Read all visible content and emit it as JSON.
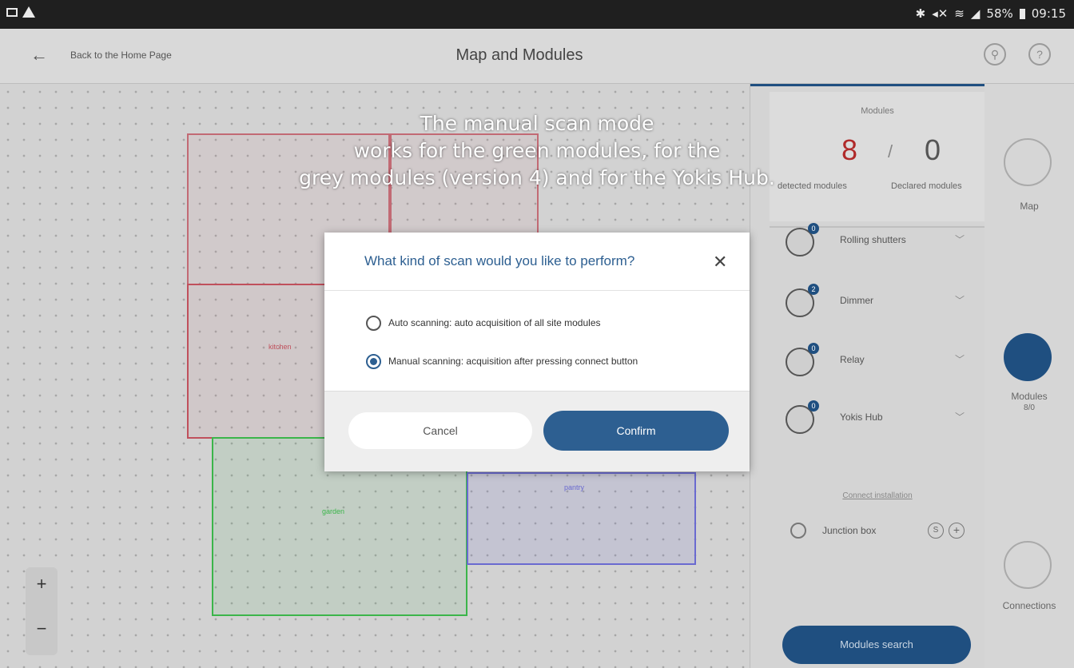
{
  "status_bar": {
    "battery": "58%",
    "time": "09:15"
  },
  "header": {
    "back_label": "Back to the Home Page",
    "title": "Map and Modules"
  },
  "map": {
    "rooms": [
      "kitchen",
      "garden",
      "pantry"
    ],
    "zoom_in": "+",
    "zoom_out": "−"
  },
  "modules_panel": {
    "title": "Modules",
    "detected_count": "8",
    "separator": "/",
    "declared_count": "0",
    "detected_label": "detected modules",
    "declared_label": "Declared modules",
    "items": [
      {
        "label": "Rolling shutters",
        "badge": "0"
      },
      {
        "label": "Dimmer",
        "badge": "2"
      },
      {
        "label": "Relay",
        "badge": "0"
      },
      {
        "label": "Yokis Hub",
        "badge": "0"
      }
    ],
    "connections_title": "Connect installation",
    "junction_label": "Junction box",
    "search_button": "Modules search"
  },
  "right_rail": {
    "map_label": "Map",
    "modules_label": "Modules",
    "modules_count": "8/0",
    "connections_label": "Connections"
  },
  "caption": {
    "line1": "The manual scan mode",
    "line2": "works for the green modules, for the",
    "line3": "grey modules (version 4) and for the Yokis Hub."
  },
  "dialog": {
    "title": "What kind of scan would you like to perform?",
    "close": "✕",
    "option_auto": "Auto scanning: auto acquisition of all site modules",
    "option_manual": "Manual scanning: acquisition after pressing connect button",
    "selected": "manual",
    "cancel_label": "Cancel",
    "confirm_label": "Confirm"
  },
  "colors": {
    "accent": "#2d5f91",
    "alert_red": "#b02a2a"
  }
}
